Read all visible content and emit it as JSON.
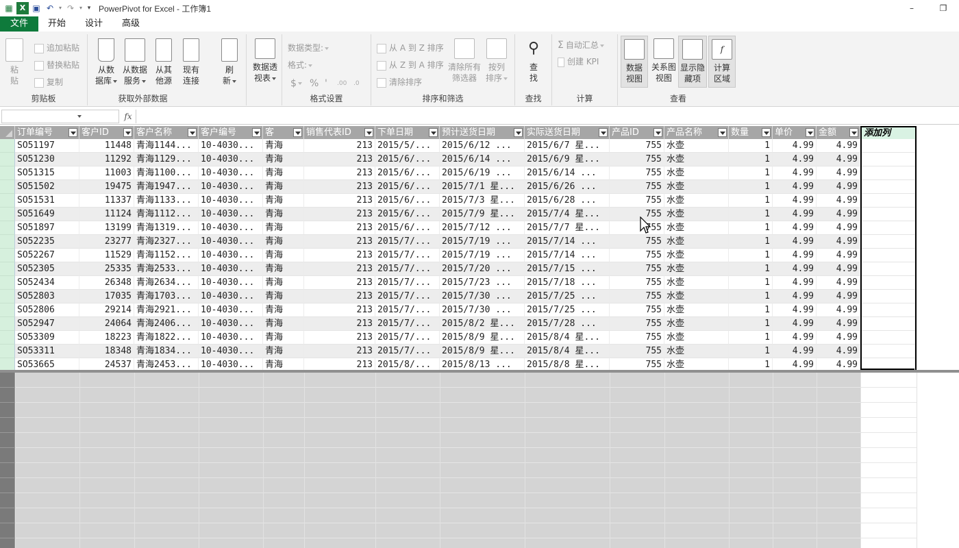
{
  "app": {
    "title": "PowerPivot for Excel - 工作簿1"
  },
  "window_controls": {
    "minimize": "–",
    "restore": "❐"
  },
  "tabs": [
    "文件",
    "开始",
    "设计",
    "高级"
  ],
  "ribbon": {
    "clipboard": {
      "label": "剪贴板",
      "paste": "粘\n贴",
      "append_paste": "追加粘贴",
      "replace_paste": "替换粘贴",
      "copy": "复制"
    },
    "external": {
      "label": "获取外部数据",
      "from_db": "从数\n据库",
      "from_service": "从数据\n服务",
      "from_other": "从其\n他源",
      "existing": "现有\n连接"
    },
    "refresh": {
      "label": "刷\n新"
    },
    "pivot": {
      "label": "数据透\n视表"
    },
    "format": {
      "label": "格式设置",
      "data_type": "数据类型:",
      "format": "格式:",
      "currency": "$",
      "percent": "%",
      "comma": "'",
      "inc": ".0→.00",
      "dec": ".00→.0"
    },
    "sort": {
      "label": "排序和筛选",
      "a_to_z": "从 A 到 Z 排序",
      "z_to_a": "从 Z 到 A 排序",
      "clear_sort": "清除排序",
      "clear_filters": "清除所有\n筛选器",
      "sort_by_col": "按列\n排序"
    },
    "find": {
      "label": "查找",
      "btn": "查\n找"
    },
    "calc": {
      "label": "计算",
      "autosum": "自动汇总",
      "kpi": "创建 KPI"
    },
    "view": {
      "label": "查看",
      "data_view": "数据\n视图",
      "diagram_view": "关系图\n视图",
      "show_hidden": "显示隐\n藏项",
      "calc_area": "计算\n区域"
    }
  },
  "formula_bar": {
    "fx": "fx",
    "name_box": "",
    "formula": ""
  },
  "grid": {
    "columns": [
      "订单编号",
      "客户ID",
      "客户名称",
      "客户编号",
      "客",
      "销售代表ID",
      "下单日期",
      "预计送货日期",
      "实际送货日期",
      "产品ID",
      "产品名称",
      "数量",
      "单价",
      "金额"
    ],
    "add_column": "添加列",
    "rows": [
      [
        "SO51197",
        "11448",
        "青海1144...",
        "10-4030...",
        "青海",
        "213",
        "2015/5/...",
        "2015/6/12 ...",
        "2015/6/7 星...",
        "755",
        "水壶",
        "1",
        "4.99",
        "4.99"
      ],
      [
        "SO51230",
        "11292",
        "青海1129...",
        "10-4030...",
        "青海",
        "213",
        "2015/6/...",
        "2015/6/14 ...",
        "2015/6/9 星...",
        "755",
        "水壶",
        "1",
        "4.99",
        "4.99"
      ],
      [
        "SO51315",
        "11003",
        "青海1100...",
        "10-4030...",
        "青海",
        "213",
        "2015/6/...",
        "2015/6/19 ...",
        "2015/6/14 ...",
        "755",
        "水壶",
        "1",
        "4.99",
        "4.99"
      ],
      [
        "SO51502",
        "19475",
        "青海1947...",
        "10-4030...",
        "青海",
        "213",
        "2015/6/...",
        "2015/7/1 星...",
        "2015/6/26 ...",
        "755",
        "水壶",
        "1",
        "4.99",
        "4.99"
      ],
      [
        "SO51531",
        "11337",
        "青海1133...",
        "10-4030...",
        "青海",
        "213",
        "2015/6/...",
        "2015/7/3 星...",
        "2015/6/28 ...",
        "755",
        "水壶",
        "1",
        "4.99",
        "4.99"
      ],
      [
        "SO51649",
        "11124",
        "青海1112...",
        "10-4030...",
        "青海",
        "213",
        "2015/6/...",
        "2015/7/9 星...",
        "2015/7/4 星...",
        "755",
        "水壶",
        "1",
        "4.99",
        "4.99"
      ],
      [
        "SO51897",
        "13199",
        "青海1319...",
        "10-4030...",
        "青海",
        "213",
        "2015/6/...",
        "2015/7/12 ...",
        "2015/7/7 星...",
        "755",
        "水壶",
        "1",
        "4.99",
        "4.99"
      ],
      [
        "SO52235",
        "23277",
        "青海2327...",
        "10-4030...",
        "青海",
        "213",
        "2015/7/...",
        "2015/7/19 ...",
        "2015/7/14 ...",
        "755",
        "水壶",
        "1",
        "4.99",
        "4.99"
      ],
      [
        "SO52267",
        "11529",
        "青海1152...",
        "10-4030...",
        "青海",
        "213",
        "2015/7/...",
        "2015/7/19 ...",
        "2015/7/14 ...",
        "755",
        "水壶",
        "1",
        "4.99",
        "4.99"
      ],
      [
        "SO52305",
        "25335",
        "青海2533...",
        "10-4030...",
        "青海",
        "213",
        "2015/7/...",
        "2015/7/20 ...",
        "2015/7/15 ...",
        "755",
        "水壶",
        "1",
        "4.99",
        "4.99"
      ],
      [
        "SO52434",
        "26348",
        "青海2634...",
        "10-4030...",
        "青海",
        "213",
        "2015/7/...",
        "2015/7/23 ...",
        "2015/7/18 ...",
        "755",
        "水壶",
        "1",
        "4.99",
        "4.99"
      ],
      [
        "SO52803",
        "17035",
        "青海1703...",
        "10-4030...",
        "青海",
        "213",
        "2015/7/...",
        "2015/7/30 ...",
        "2015/7/25 ...",
        "755",
        "水壶",
        "1",
        "4.99",
        "4.99"
      ],
      [
        "SO52806",
        "29214",
        "青海2921...",
        "10-4030...",
        "青海",
        "213",
        "2015/7/...",
        "2015/7/30 ...",
        "2015/7/25 ...",
        "755",
        "水壶",
        "1",
        "4.99",
        "4.99"
      ],
      [
        "SO52947",
        "24064",
        "青海2406...",
        "10-4030...",
        "青海",
        "213",
        "2015/7/...",
        "2015/8/2 星...",
        "2015/7/28 ...",
        "755",
        "水壶",
        "1",
        "4.99",
        "4.99"
      ],
      [
        "SO53309",
        "18223",
        "青海1822...",
        "10-4030...",
        "青海",
        "213",
        "2015/7/...",
        "2015/8/9 星...",
        "2015/8/4 星...",
        "755",
        "水壶",
        "1",
        "4.99",
        "4.99"
      ],
      [
        "SO53311",
        "18348",
        "青海1834...",
        "10-4030...",
        "青海",
        "213",
        "2015/7/...",
        "2015/8/9 星...",
        "2015/8/4 星...",
        "755",
        "水壶",
        "1",
        "4.99",
        "4.99"
      ],
      [
        "SO53665",
        "24537",
        "青海2453...",
        "10-4030...",
        "青海",
        "213",
        "2015/8/...",
        "2015/8/13 ...",
        "2015/8/8 星...",
        "755",
        "水壶",
        "1",
        "4.99",
        "4.99"
      ]
    ]
  },
  "colors": {
    "file_tab": "#0e7a3b",
    "header_bg": "#a6a6a6",
    "row_selector": "#d6f0dd",
    "add_column_header": "#d9f2e3"
  },
  "icons": {
    "app": "excel-icon",
    "save": "save-icon",
    "undo": "undo-icon",
    "redo": "redo-icon"
  }
}
